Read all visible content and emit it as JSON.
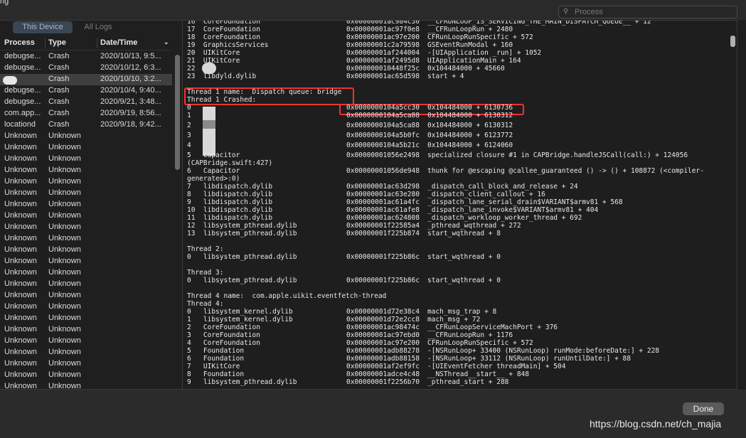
{
  "window_title_fragment": "ng",
  "search": {
    "placeholder": "Process"
  },
  "tabs": {
    "active": "This Device",
    "inactive": "All Logs"
  },
  "columns": {
    "process": "Process",
    "type": "Type",
    "datetime": "Date/Time"
  },
  "rows": [
    {
      "process": "debugse...",
      "type": "Crash",
      "date": "2020/10/13, 9:5..."
    },
    {
      "process": "debugse...",
      "type": "Crash",
      "date": "2020/10/12, 6:3..."
    },
    {
      "process": "",
      "type": "Crash",
      "date": "2020/10/10, 3:2..."
    },
    {
      "process": "debugse...",
      "type": "Crash",
      "date": "2020/10/4, 9:40..."
    },
    {
      "process": "debugse...",
      "type": "Crash",
      "date": "2020/9/21, 3:48..."
    },
    {
      "process": "com.app...",
      "type": "Crash",
      "date": "2020/9/19, 8:56..."
    },
    {
      "process": "locationd",
      "type": "Crash",
      "date": "2020/9/18, 9:42..."
    },
    {
      "process": "Unknown",
      "type": "Unknown",
      "date": ""
    },
    {
      "process": "Unknown",
      "type": "Unknown",
      "date": ""
    },
    {
      "process": "Unknown",
      "type": "Unknown",
      "date": ""
    },
    {
      "process": "Unknown",
      "type": "Unknown",
      "date": ""
    },
    {
      "process": "Unknown",
      "type": "Unknown",
      "date": ""
    },
    {
      "process": "Unknown",
      "type": "Unknown",
      "date": ""
    },
    {
      "process": "Unknown",
      "type": "Unknown",
      "date": ""
    },
    {
      "process": "Unknown",
      "type": "Unknown",
      "date": ""
    },
    {
      "process": "Unknown",
      "type": "Unknown",
      "date": ""
    },
    {
      "process": "Unknown",
      "type": "Unknown",
      "date": ""
    },
    {
      "process": "Unknown",
      "type": "Unknown",
      "date": ""
    },
    {
      "process": "Unknown",
      "type": "Unknown",
      "date": ""
    },
    {
      "process": "Unknown",
      "type": "Unknown",
      "date": ""
    },
    {
      "process": "Unknown",
      "type": "Unknown",
      "date": ""
    },
    {
      "process": "Unknown",
      "type": "Unknown",
      "date": ""
    },
    {
      "process": "Unknown",
      "type": "Unknown",
      "date": ""
    },
    {
      "process": "Unknown",
      "type": "Unknown",
      "date": ""
    },
    {
      "process": "Unknown",
      "type": "Unknown",
      "date": ""
    },
    {
      "process": "Unknown",
      "type": "Unknown",
      "date": ""
    },
    {
      "process": "Unknown",
      "type": "Unknown",
      "date": ""
    },
    {
      "process": "Unknown",
      "type": "Unknown",
      "date": ""
    },
    {
      "process": "Unknown",
      "type": "Unknown",
      "date": ""
    },
    {
      "process": "Unknown",
      "type": "Unknown",
      "date": ""
    },
    {
      "process": "Unknown",
      "type": "Unknown",
      "date": ""
    },
    {
      "process": "Unknown",
      "type": "Unknown",
      "date": ""
    }
  ],
  "log_lines": [
    {
      "t": "16  CoreFoundation",
      "a": "0x00000001ac984c30",
      "s": "__CFRUNLOOP_IS_SERVICING_THE_MAIN_DISPATCH_QUEUE__ + 12"
    },
    {
      "t": "17  CoreFoundation",
      "a": "0x00000001ac97f0e8",
      "s": "__CFRunLoopRun + 2480"
    },
    {
      "t": "18  CoreFoundation",
      "a": "0x00000001ac97e200",
      "s": "CFRunLoopRunSpecific + 572"
    },
    {
      "t": "19  GraphicsServices",
      "a": "0x00000001c2a79598",
      "s": "GSEventRunModal + 160"
    },
    {
      "t": "20  UIKitCore",
      "a": "0x00000001af244004",
      "s": "-[UIApplication _run] + 1052"
    },
    {
      "t": "21  UIKitCore",
      "a": "0x00000001af2495d8",
      "s": "UIApplicationMain + 164"
    },
    {
      "t": "22",
      "a": "0x000000010448f25c",
      "s": "0x104484000 + 45660"
    },
    {
      "t": "23  libdyld.dylib",
      "a": "0x00000001ac65d598",
      "s": "start + 4"
    },
    {
      "t": "",
      "a": "",
      "s": ""
    },
    {
      "t": "Thread 1 name:  Dispatch queue: bridge",
      "a": "",
      "s": ""
    },
    {
      "t": "Thread 1 Crashed:",
      "a": "",
      "s": ""
    },
    {
      "t": "0",
      "a": "0x0000000104a5cc30",
      "s": "0x104484000 + 6130736"
    },
    {
      "t": "1",
      "a": "0x0000000104a5ca88",
      "s": "0x104484000 + 6130312"
    },
    {
      "t": "2",
      "a": "0x0000000104a5ca88",
      "s": "0x104484000 + 6130312"
    },
    {
      "t": "3",
      "a": "0x0000000104a5b0fc",
      "s": "0x104484000 + 6123772"
    },
    {
      "t": "4",
      "a": "0x0000000104a5b21c",
      "s": "0x104484000 + 6124060"
    },
    {
      "t": "5   Capacitor",
      "a": "0x00000001056e2498",
      "s": "specialized closure #1 in CAPBridge.handleJSCall(call:) + 124056"
    },
    {
      "t": "(CAPBridge.swift:427)",
      "a": "",
      "s": ""
    },
    {
      "t": "6   Capacitor",
      "a": "0x00000001056de948",
      "s": "thunk for @escaping @callee_guaranteed () -> () + 108872 (<compiler-"
    },
    {
      "t": "generated>:0)",
      "a": "",
      "s": ""
    },
    {
      "t": "7   libdispatch.dylib",
      "a": "0x00000001ac63d298",
      "s": "_dispatch_call_block_and_release + 24"
    },
    {
      "t": "8   libdispatch.dylib",
      "a": "0x00000001ac63e280",
      "s": "_dispatch_client_callout + 16"
    },
    {
      "t": "9   libdispatch.dylib",
      "a": "0x00000001ac61a4fc",
      "s": "_dispatch_lane_serial_drain$VARIANT$armv81 + 568"
    },
    {
      "t": "10  libdispatch.dylib",
      "a": "0x00000001ac61afe8",
      "s": "_dispatch_lane_invoke$VARIANT$armv81 + 404"
    },
    {
      "t": "11  libdispatch.dylib",
      "a": "0x00000001ac624808",
      "s": "_dispatch_workloop_worker_thread + 692"
    },
    {
      "t": "12  libsystem_pthread.dylib",
      "a": "0x00000001f22585a4",
      "s": "_pthread_wqthread + 272"
    },
    {
      "t": "13  libsystem_pthread.dylib",
      "a": "0x00000001f225b874",
      "s": "start_wqthread + 8"
    },
    {
      "t": "",
      "a": "",
      "s": ""
    },
    {
      "t": "Thread 2:",
      "a": "",
      "s": ""
    },
    {
      "t": "0   libsystem_pthread.dylib",
      "a": "0x00000001f225b86c",
      "s": "start_wqthread + 0"
    },
    {
      "t": "",
      "a": "",
      "s": ""
    },
    {
      "t": "Thread 3:",
      "a": "",
      "s": ""
    },
    {
      "t": "0   libsystem_pthread.dylib",
      "a": "0x00000001f225b86c",
      "s": "start_wqthread + 0"
    },
    {
      "t": "",
      "a": "",
      "s": ""
    },
    {
      "t": "Thread 4 name:  com.apple.uikit.eventfetch-thread",
      "a": "",
      "s": ""
    },
    {
      "t": "Thread 4:",
      "a": "",
      "s": ""
    },
    {
      "t": "0   libsystem_kernel.dylib",
      "a": "0x00000001d72e38c4",
      "s": "mach_msg_trap + 8"
    },
    {
      "t": "1   libsystem_kernel.dylib",
      "a": "0x00000001d72e2cc8",
      "s": "mach_msg + 72"
    },
    {
      "t": "2   CoreFoundation",
      "a": "0x00000001ac98474c",
      "s": "__CFRunLoopServiceMachPort + 376"
    },
    {
      "t": "3   CoreFoundation",
      "a": "0x00000001ac97ebd0",
      "s": "__CFRunLoopRun + 1176"
    },
    {
      "t": "4   CoreFoundation",
      "a": "0x00000001ac97e200",
      "s": "CFRunLoopRunSpecific + 572"
    },
    {
      "t": "5   Foundation",
      "a": "0x00000001adb88278",
      "s": "-[NSRunLoop+ 33400 (NSRunLoop) runMode:beforeDate:] + 228"
    },
    {
      "t": "6   Foundation",
      "a": "0x00000001adb88158",
      "s": "-[NSRunLoop+ 33112 (NSRunLoop) runUntilDate:] + 88"
    },
    {
      "t": "7   UIKitCore",
      "a": "0x00000001af2ef9fc",
      "s": "-[UIEventFetcher threadMain] + 504"
    },
    {
      "t": "8   Foundation",
      "a": "0x00000001adce4c48",
      "s": "__NSThread__start__ + 848"
    },
    {
      "t": "9   libsystem_pthread.dylib",
      "a": "0x00000001f2256b70",
      "s": "_pthread_start + 288"
    }
  ],
  "done_label": "Done",
  "watermark": "https://blog.csdn.net/ch_majia"
}
